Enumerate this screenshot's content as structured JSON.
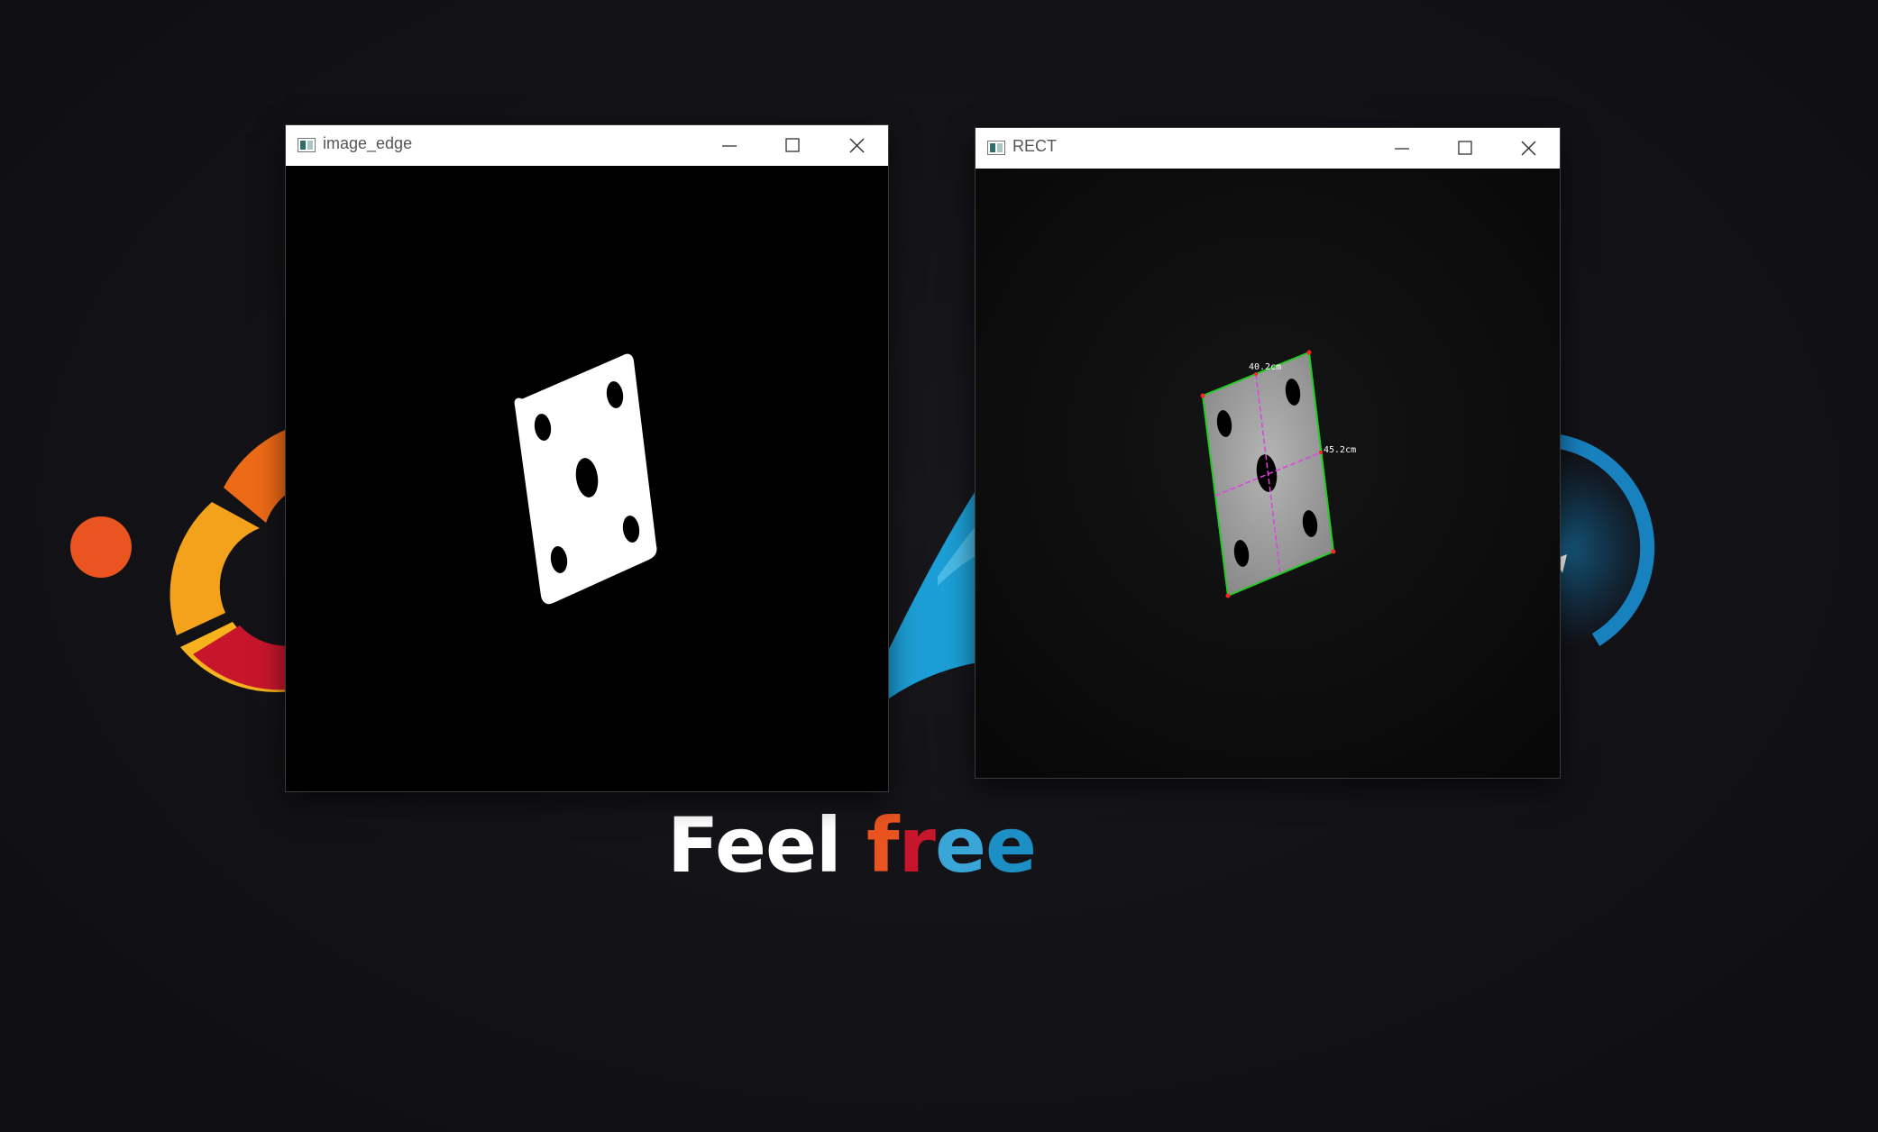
{
  "desktop": {
    "tagline_word1": "Feel",
    "tagline_word2_letters": [
      "f",
      "r",
      "e",
      "e"
    ]
  },
  "windows": [
    {
      "title": "image_edge",
      "icon": "opencv-window-icon",
      "controls": [
        "minimize-icon",
        "maximize-icon",
        "close-icon"
      ],
      "content": "binary edge image of a die showing five pips"
    },
    {
      "title": "RECT",
      "icon": "opencv-window-icon",
      "controls": [
        "minimize-icon",
        "maximize-icon",
        "close-icon"
      ],
      "annotations": {
        "top_label": "40.2cm",
        "side_label": "45.2cm"
      },
      "colors": {
        "outline": "#22cc22",
        "axes": "#e040e0",
        "corners": "#ff2222"
      }
    }
  ],
  "colors": {
    "ubuntu_orange": "#e95420",
    "ubuntu_yellow": "#f4a11b",
    "ubuntu_red": "#c7162b",
    "accent_blue": "#1c9fd6"
  }
}
